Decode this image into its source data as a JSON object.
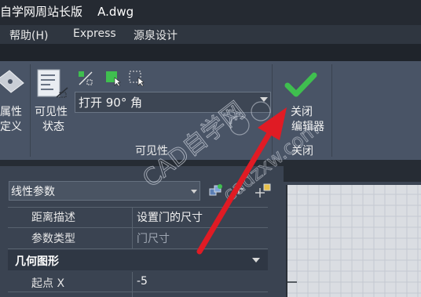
{
  "title_bar": {
    "title": "自学网周站长版    A.dwg"
  },
  "menu": {
    "items": [
      "帮助(H)",
      "Express",
      "源泉设计"
    ]
  },
  "ribbon": {
    "attr_def_label_line1": "属性",
    "attr_def_label_line2": "定义",
    "vis_state_label_line1": "可见性",
    "vis_state_label_line2": "状态",
    "dropdown_value": "打开 90° 角",
    "panel_visibility_title": "可见性",
    "close_editor_line1": "关闭",
    "close_editor_line2": "编辑器",
    "panel_close_title": "关闭"
  },
  "properties": {
    "combo_value": "线性参数",
    "rows": [
      {
        "label": "距离描述",
        "value": "设置门的尺寸",
        "muted": false
      },
      {
        "label": "参数类型",
        "value": "门尺寸",
        "muted": true
      }
    ],
    "section_title": "几何图形",
    "section_rows": [
      {
        "label": "起点 X",
        "value": "-5"
      }
    ]
  },
  "watermark": {
    "text": "CAD自学网",
    "url": "cadzxw.com"
  },
  "colors": {
    "accent_green": "#3fbf4f",
    "arrow_red": "#e01b24",
    "ribbon_bg": "#495466"
  }
}
